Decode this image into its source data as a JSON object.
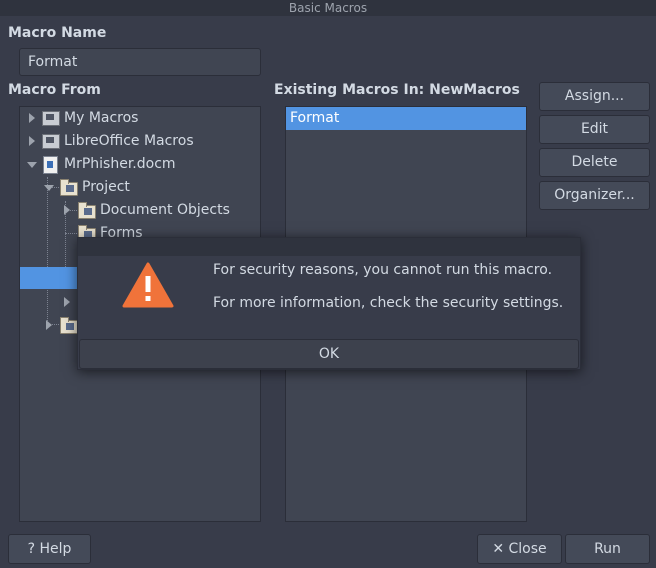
{
  "window": {
    "title": "Basic Macros"
  },
  "macro_name": {
    "label": "Macro Name",
    "value": "Format"
  },
  "macro_from": {
    "label": "Macro From",
    "tree": {
      "my_macros": "My Macros",
      "libreoffice_macros": "LibreOffice Macros",
      "document": "MrPhisher.docm",
      "project": "Project",
      "document_objects": "Document Objects",
      "forms": "Forms"
    }
  },
  "existing_macros": {
    "label": "Existing Macros In: NewMacros",
    "items": [
      "Format"
    ]
  },
  "buttons": {
    "assign": "Assign...",
    "edit": "Edit",
    "delete": "Delete",
    "organizer": "Organizer...",
    "help": "Help",
    "close": "Close",
    "run": "Run"
  },
  "dialog": {
    "message": "For security reasons, you cannot run this macro.",
    "detail": "For more information, check the security settings.",
    "ok": "OK"
  },
  "colors": {
    "background": "#383c4a",
    "selection": "#5294e2",
    "warning": "#f0733a"
  }
}
